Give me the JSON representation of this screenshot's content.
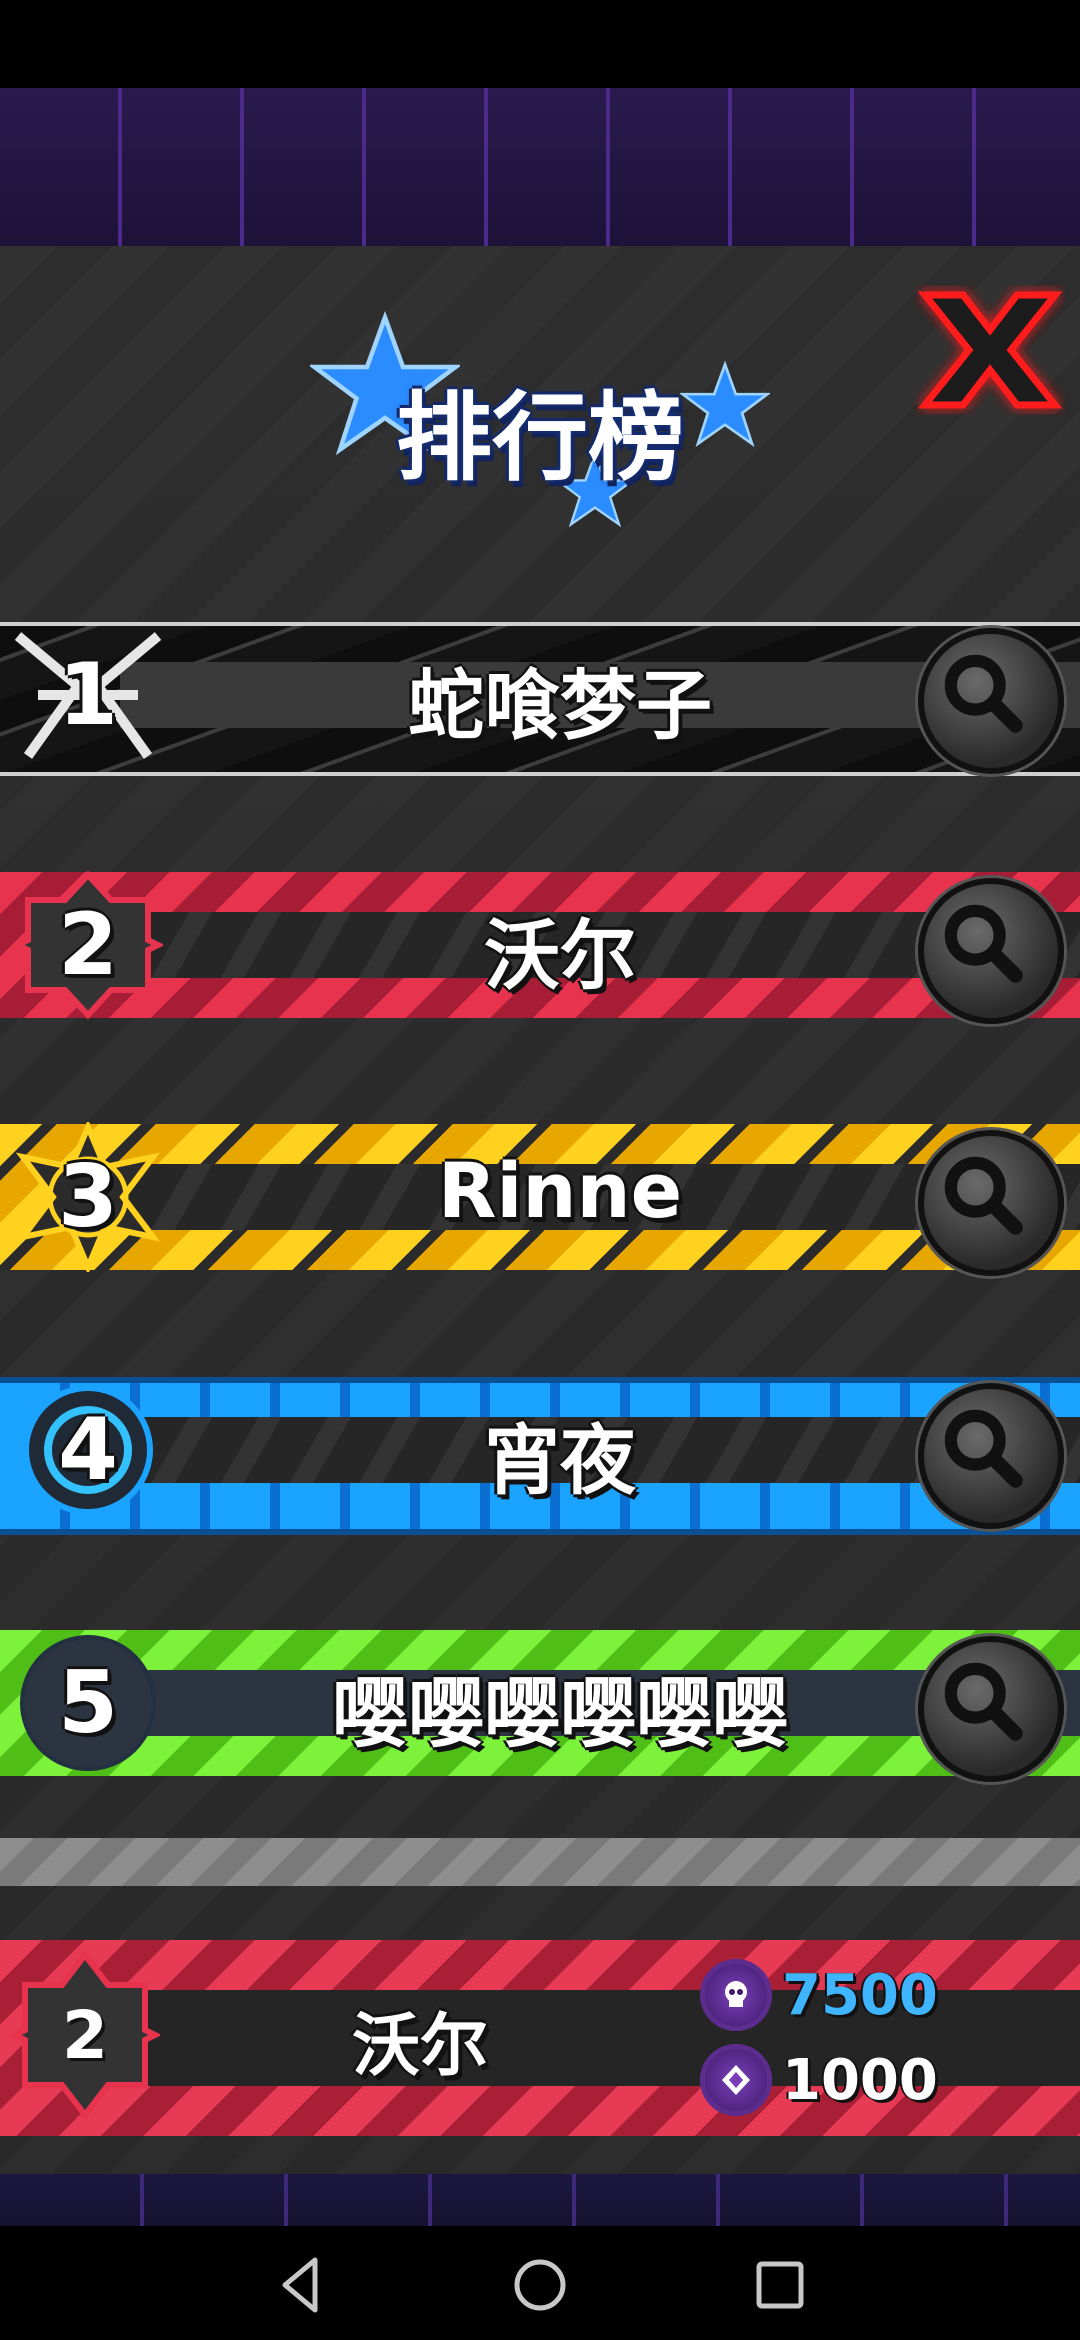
{
  "title": "排行榜",
  "leaderboard": [
    {
      "rank": "1",
      "name": "蛇喰梦子"
    },
    {
      "rank": "2",
      "name": "沃尔"
    },
    {
      "rank": "3",
      "name": "Rinne"
    },
    {
      "rank": "4",
      "name": "宵夜"
    },
    {
      "rank": "5",
      "name": "嘤嘤嘤嘤嘤嘤"
    }
  ],
  "my_entry": {
    "rank": "2",
    "name": "沃尔",
    "score": "7500",
    "secondary_score": "1000"
  },
  "colors": {
    "rank1": "#1b1b1b",
    "rank2": "#e8334f",
    "rank3": "#ffcc1a",
    "rank4": "#1aa3ff",
    "rank5": "#6be62a",
    "score_blue": "#3fb4ff",
    "close_red": "#ff1a1a",
    "star_blue": "#2a8cff"
  },
  "icons": [
    "star-icon",
    "close-icon",
    "search-icon",
    "skull-coin-icon",
    "gem-coin-icon",
    "nav-back-icon",
    "nav-home-icon",
    "nav-recents-icon"
  ]
}
